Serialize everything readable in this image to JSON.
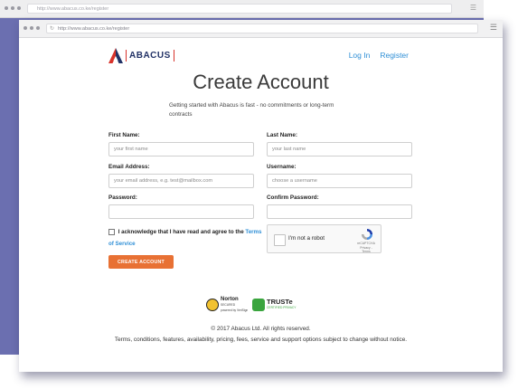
{
  "back_browser": {
    "url": "http://www.abacus.co.ke/register"
  },
  "browser": {
    "url": "http://www.abacus.co.ke/register"
  },
  "brand": {
    "name": "ABACUS",
    "primary": "#223266",
    "accent": "#d8332b"
  },
  "nav": {
    "login": "Log In",
    "register": "Register",
    "link_color": "#2f8fd6"
  },
  "page": {
    "title": "Create Account",
    "subtitle": "Getting started with Abacus is fast - no commitments or long-term contracts"
  },
  "form": {
    "first_name": {
      "label": "First Name:",
      "placeholder": "your first name"
    },
    "last_name": {
      "label": "Last Name:",
      "placeholder": "your last name"
    },
    "email": {
      "label": "Email Address:",
      "placeholder": "your email address, e.g. test@mailbox.com"
    },
    "username": {
      "label": "Username:",
      "placeholder": "choose a username"
    },
    "password": {
      "label": "Password:",
      "placeholder": ""
    },
    "confirm_password": {
      "label": "Confirm Password:",
      "placeholder": ""
    },
    "agree_text": "I acknowledge that I have read and agree to the",
    "terms_link": "Terms of Service",
    "submit": "CREATE ACCOUNT",
    "submit_color": "#e87134"
  },
  "captcha": {
    "label": "I'm not a robot",
    "brand": "reCAPTCHA",
    "links": "Privacy - Terms"
  },
  "badges": {
    "norton": {
      "name": "Norton",
      "sub1": "SECURED",
      "sub2": "powered by VeriSign"
    },
    "truste": {
      "name": "TRUSTe",
      "sub": "CERTIFIED PRIVACY"
    }
  },
  "footer": {
    "copyright": "© 2017 Abacus Ltd. All rights reserved.",
    "terms": "Terms, conditions, features, availability, pricing, fees, service and support options subject to change without notice."
  }
}
